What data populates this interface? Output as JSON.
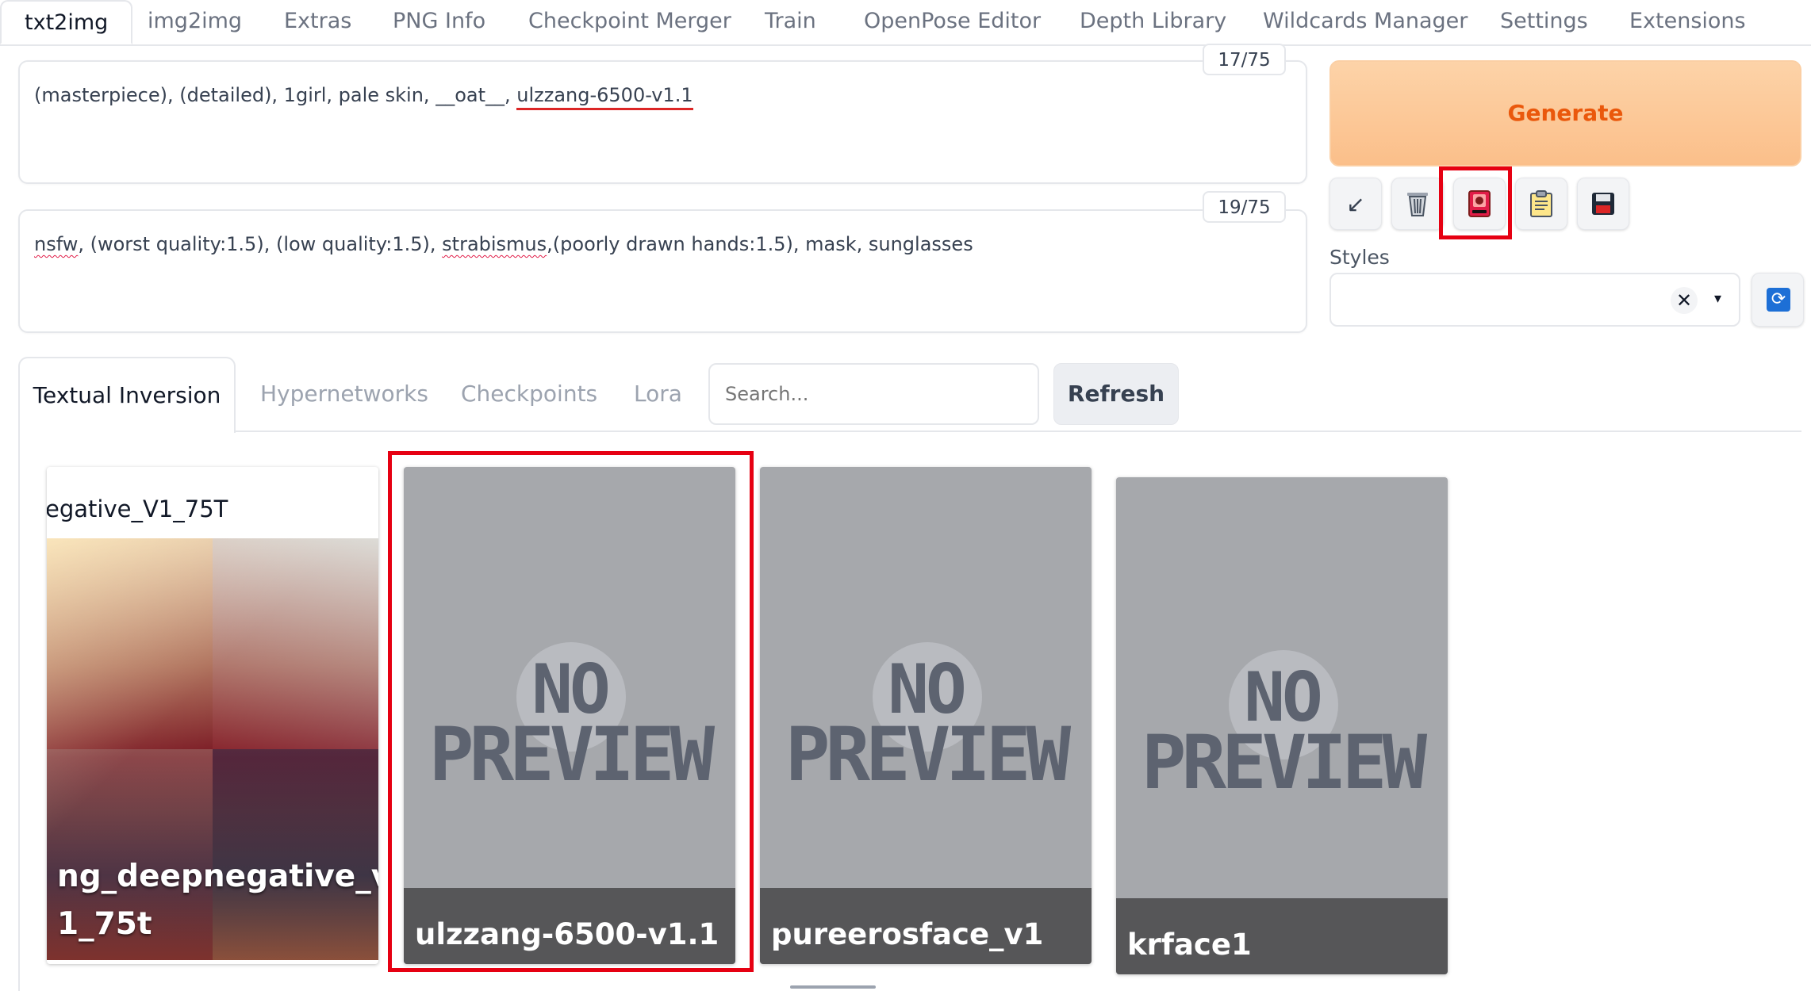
{
  "top_tabs": [
    "txt2img",
    "img2img",
    "Extras",
    "PNG Info",
    "Checkpoint Merger",
    "Train",
    "OpenPose Editor",
    "Depth Library",
    "Wildcards Manager",
    "Settings",
    "Extensions"
  ],
  "prompt": {
    "segments": [
      "(masterpiece), (detailed), 1girl, pale skin, __oat__, ",
      "ulzzang-6500-v1.1"
    ],
    "counter": "17/75"
  },
  "negative_prompt": {
    "segments": [
      "nsfw",
      ", (worst quality:1.5), (low quality:1.5), ",
      "strabismus",
      ",(poorly drawn hands:1.5), mask, sunglasses"
    ],
    "counter": "19/75"
  },
  "generate": {
    "label": "Generate"
  },
  "tool_icons": [
    "arrow-icon",
    "trash-icon",
    "extra-networks-icon",
    "clipboard-icon",
    "save-icon"
  ],
  "styles": {
    "label": "Styles",
    "clear": "✕",
    "caret": "▾"
  },
  "extra_networks": {
    "tabs": [
      "Textual Inversion",
      "Hypernetworks",
      "Checkpoints",
      "Lora"
    ],
    "search_placeholder": "Search...",
    "refresh_label": "Refresh"
  },
  "cards": [
    {
      "header": "egative_V1_75T",
      "name_line1": "ng_deepnegative_v",
      "name_line2": "1_75t",
      "preview": "image"
    },
    {
      "name": "ulzzang-6500-v1.1",
      "preview_text": [
        "NO",
        "PREVIEW"
      ]
    },
    {
      "name": "pureerosface_v1",
      "preview_text": [
        "NO",
        "PREVIEW"
      ]
    },
    {
      "name": "krface1",
      "preview_text": [
        "NO",
        "PREVIEW"
      ]
    }
  ],
  "colors": {
    "highlight": "#e60012",
    "generate_text": "#ea580c",
    "accent_blue": "#1d6fd6"
  }
}
